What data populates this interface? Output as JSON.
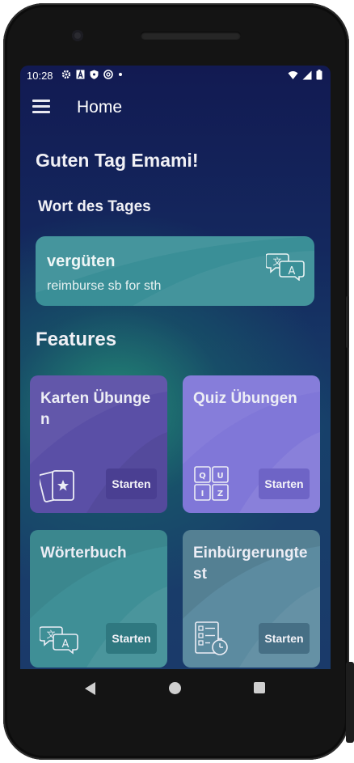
{
  "status_bar": {
    "time": "10:28",
    "left_icons": [
      "gear-icon",
      "font-a-icon",
      "shield-icon",
      "vpn-icon",
      "dot-icon"
    ],
    "right_icons": [
      "wifi-icon",
      "signal-icon",
      "battery-icon"
    ]
  },
  "app_bar": {
    "title": "Home",
    "menu_icon": "hamburger-menu-icon"
  },
  "main": {
    "greeting": "Guten Tag Emami!",
    "word_of_the_day": {
      "heading": "Wort des Tages",
      "word": "vergüten",
      "translation": "reimburse sb for sth",
      "icon": "translate-icon"
    },
    "features_heading": "Features",
    "features": [
      {
        "title": "Karten Übungen",
        "button": "Starten",
        "icon": "flashcards-icon",
        "color": "#5a4fa6"
      },
      {
        "title": "Quiz Übungen",
        "button": "Starten",
        "icon": "quiz-icon",
        "quiz_letters": [
          "Q",
          "U",
          "I",
          "Z"
        ],
        "color": "#8077d8"
      },
      {
        "title": "Wörterbuch",
        "button": "Starten",
        "icon": "translate-icon",
        "color": "#3f8f96"
      },
      {
        "title": "Einbürgerungtest",
        "button": "Starten",
        "icon": "checklist-timer-icon",
        "color": "#5c8ba0"
      }
    ]
  },
  "nav_bar": {
    "buttons": [
      "back-icon",
      "home-icon",
      "recents-icon"
    ]
  }
}
